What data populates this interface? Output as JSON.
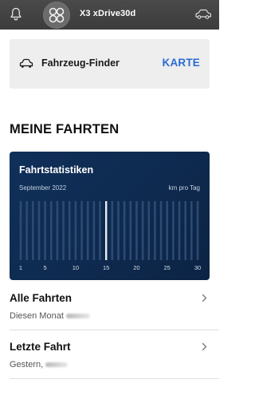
{
  "header": {
    "vehicle_name": "X3 xDrive30d",
    "icons": {
      "left": "bell-icon",
      "avatar": "four-dots-grid-icon",
      "right": "car-icon"
    }
  },
  "finder": {
    "icon": "car-icon",
    "label": "Fahrzeug-Finder",
    "link_label": "KARTE"
  },
  "section": {
    "title": "MEINE FAHRTEN"
  },
  "stats": {
    "title": "Fahrtstatistiken",
    "month": "September 2022",
    "unit": "km pro Tag"
  },
  "chart_data": {
    "type": "bar",
    "title": "Fahrtstatistiken",
    "subtitle": "September 2022",
    "ylabel": "km pro Tag",
    "x_ticks": [
      "1",
      "5",
      "10",
      "15",
      "20",
      "25",
      "30"
    ],
    "days": [
      1,
      2,
      3,
      4,
      5,
      6,
      7,
      8,
      9,
      10,
      11,
      12,
      13,
      14,
      15,
      16,
      17,
      18,
      19,
      20,
      21,
      22,
      23,
      24,
      25,
      26,
      27,
      28,
      29,
      30
    ],
    "highlighted_day": 15
  },
  "list": [
    {
      "title": "Alle Fahrten",
      "subtitle": "Diesen Monat",
      "icon": "chevron-right-icon"
    },
    {
      "title": "Letzte Fahrt",
      "subtitle": "Gestern,",
      "icon": "chevron-right-icon"
    }
  ],
  "colors": {
    "header_bg": "#424242",
    "accent_link": "#2a6bd1",
    "card_bg": "#0f2d54"
  }
}
